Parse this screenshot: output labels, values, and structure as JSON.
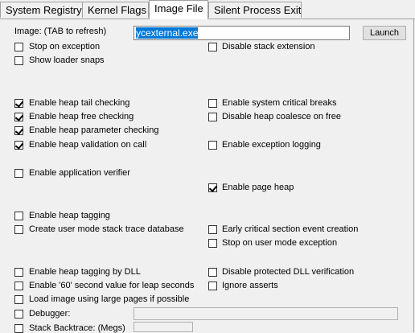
{
  "tabs": [
    {
      "label": "System Registry"
    },
    {
      "label": "Kernel Flags"
    },
    {
      "label": "Image File"
    },
    {
      "label": "Silent Process Exit"
    }
  ],
  "image": {
    "label": "Image: (TAB to refresh)",
    "value": "ycexternal.exe",
    "launch": "Launch"
  },
  "left_options": [
    {
      "label": "Stop on exception",
      "checked": false
    },
    {
      "label": "Show loader snaps",
      "checked": false
    },
    {
      "label": "Enable heap tail checking",
      "checked": true
    },
    {
      "label": "Enable heap free checking",
      "checked": true
    },
    {
      "label": "Enable heap parameter checking",
      "checked": true
    },
    {
      "label": "Enable heap validation on call",
      "checked": true
    },
    {
      "label": "Enable application verifier",
      "checked": false
    },
    {
      "label": "Enable heap tagging",
      "checked": false
    },
    {
      "label": "Create user mode stack trace database",
      "checked": false
    },
    {
      "label": "Enable heap tagging by DLL",
      "checked": false
    },
    {
      "label": "Enable '60' second value for leap seconds",
      "checked": false
    },
    {
      "label": "Load image using large pages if possible",
      "checked": false
    },
    {
      "label": "Debugger:",
      "checked": false
    },
    {
      "label": "Stack Backtrace: (Megs)",
      "checked": false
    }
  ],
  "right_options": [
    {
      "label": "Disable stack extension",
      "checked": false
    },
    {
      "label": "Enable system critical breaks",
      "checked": false
    },
    {
      "label": "Disable heap coalesce on free",
      "checked": false
    },
    {
      "label": "Enable exception logging",
      "checked": false
    },
    {
      "label": "Enable page heap",
      "checked": true
    },
    {
      "label": "Early critical section event creation",
      "checked": false
    },
    {
      "label": "Stop on user mode exception",
      "checked": false
    },
    {
      "label": "Disable protected DLL verification",
      "checked": false
    },
    {
      "label": "Ignore asserts",
      "checked": false
    }
  ],
  "debugger": {
    "value": ""
  },
  "stack_backtrace": {
    "value": ""
  }
}
